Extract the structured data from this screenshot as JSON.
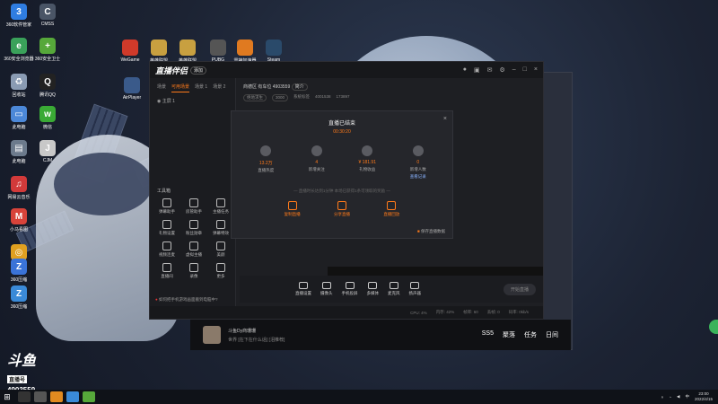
{
  "desktop_icons": [
    {
      "label": "360软件管家",
      "color": "#2f7de1",
      "glyph": "3"
    },
    {
      "label": "CMSS",
      "color": "#4a5566",
      "glyph": "C"
    },
    {
      "label": "360安全浏览器",
      "color": "#3aa15a",
      "glyph": "e"
    },
    {
      "label": "360安全卫士",
      "color": "#56a83a",
      "glyph": "+"
    },
    {
      "label": "回收站",
      "color": "#8a9bb3",
      "glyph": "♻"
    },
    {
      "label": "腾讯QQ",
      "color": "#222222",
      "glyph": "Q"
    },
    {
      "label": "此电脑",
      "color": "#4c88d8",
      "glyph": "▭"
    },
    {
      "label": "微信",
      "color": "#3aaa35",
      "glyph": "w"
    },
    {
      "label": "此电脑",
      "color": "#6c7a8c",
      "glyph": "▤"
    },
    {
      "label": "CJM",
      "color": "#c8c8c8",
      "glyph": "J"
    },
    {
      "label": "网易云音乐",
      "color": "#d23a3a",
      "glyph": "♫"
    },
    {
      "label": "小马看图",
      "color": "#d8433a",
      "glyph": "M"
    },
    {
      "label": "Google Chrome",
      "color": "#e0a020",
      "glyph": "◎"
    },
    {
      "label": "360压缩",
      "color": "#3a73d8",
      "glyph": "Z"
    },
    {
      "label": "360压缩",
      "color": "#3a8ad8",
      "glyph": "Z"
    }
  ],
  "top_icons": [
    {
      "label": "WeGame",
      "color": "#d03a2a"
    },
    {
      "label": "英雄联盟",
      "color": "#c8a040"
    },
    {
      "label": "英雄联盟",
      "color": "#c8a040"
    },
    {
      "label": "PUBG",
      "color": "#555555"
    },
    {
      "label": "雷神加速器",
      "color": "#e07a20"
    },
    {
      "label": "Steam",
      "color": "#2a4a6a"
    },
    {
      "label": "AirPlayer",
      "color": "#3a5a8a"
    }
  ],
  "app": {
    "logo": "直播伴侣",
    "logo_badge": "添加",
    "room_title": "商德区 有车位 4903559",
    "room_tag": "简介",
    "room_meta": [
      "绝地求生",
      "3000",
      "系统标签",
      "4001538",
      "173897"
    ],
    "tabs": [
      "场景",
      "可用场景",
      "场景 1",
      "场景 2"
    ],
    "scene_name": "主屏 1",
    "toolbox_title": "工具箱",
    "tools": [
      "弹幕助手",
      "房管助手",
      "主播任务",
      "礼物设置",
      "粉丝勋章",
      "弹幕特效",
      "视频连麦",
      "虚拟主播",
      "美颜",
      "直播间",
      "录像",
      "更多"
    ],
    "sidebar_footer": "如何把手机游戏画面搬到电脑中?",
    "controls": [
      "直播设置",
      "摄像头",
      "手机投屏",
      "多媒体",
      "麦克风",
      "扬声器"
    ],
    "start_button": "开始直播",
    "status_bar": [
      "CPU: 4%",
      "内存: 42%",
      "帧率: 60",
      "丢帧: 0",
      "码率: 0kb/s"
    ]
  },
  "modal": {
    "title": "直播已结束",
    "duration": "00:30:20",
    "close": "×",
    "stats": [
      {
        "value": "13.2万",
        "label": "直播热度"
      },
      {
        "value": "4",
        "label": "新增关注"
      },
      {
        "value": "¥ 181.91",
        "label": "礼物收益"
      },
      {
        "value": "0",
        "label": "新增人数"
      }
    ],
    "stat_link": "查看记录",
    "notice": "— 直播时长达到1分钟 本场已获得1条可领取的奖励 —",
    "actions": [
      "复制直播",
      "分享直播",
      "直播回放"
    ],
    "keep_label": "保存直播数据"
  },
  "douyu_bar": {
    "streamer": "斗鱼Dy商珊珊",
    "message": "世界 [在下在什么话] [泪推荐]",
    "right": [
      "SS5",
      "聚落",
      "任务",
      "日间"
    ]
  },
  "brand": {
    "name": "斗鱼",
    "sub": "直播号",
    "room": "4903559"
  },
  "taskbar": {
    "time": "23:00",
    "date": "2022/4/15",
    "ime": "中"
  }
}
